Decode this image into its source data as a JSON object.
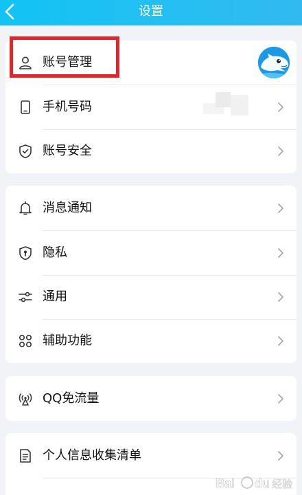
{
  "header": {
    "title": "设置"
  },
  "account_section": {
    "items": [
      {
        "label": "账号管理",
        "icon": "person-icon"
      },
      {
        "label": "手机号码",
        "icon": "phone-icon"
      },
      {
        "label": "账号安全",
        "icon": "shield-check-icon"
      }
    ]
  },
  "general_section": {
    "items": [
      {
        "label": "消息通知",
        "icon": "bell-icon"
      },
      {
        "label": "隐私",
        "icon": "privacy-shield-icon"
      },
      {
        "label": "通用",
        "icon": "sliders-icon"
      },
      {
        "label": "辅助功能",
        "icon": "grid-icon"
      }
    ]
  },
  "data_section": {
    "items": [
      {
        "label": "QQ免流量",
        "icon": "signal-icon"
      }
    ]
  },
  "info_section": {
    "items": [
      {
        "label": "个人信息收集清单",
        "icon": "document-icon"
      }
    ]
  },
  "colors": {
    "header": "#23bff2",
    "highlight": "#e3242b",
    "background": "#f2f3f6"
  },
  "watermark": "Bai du 经验"
}
